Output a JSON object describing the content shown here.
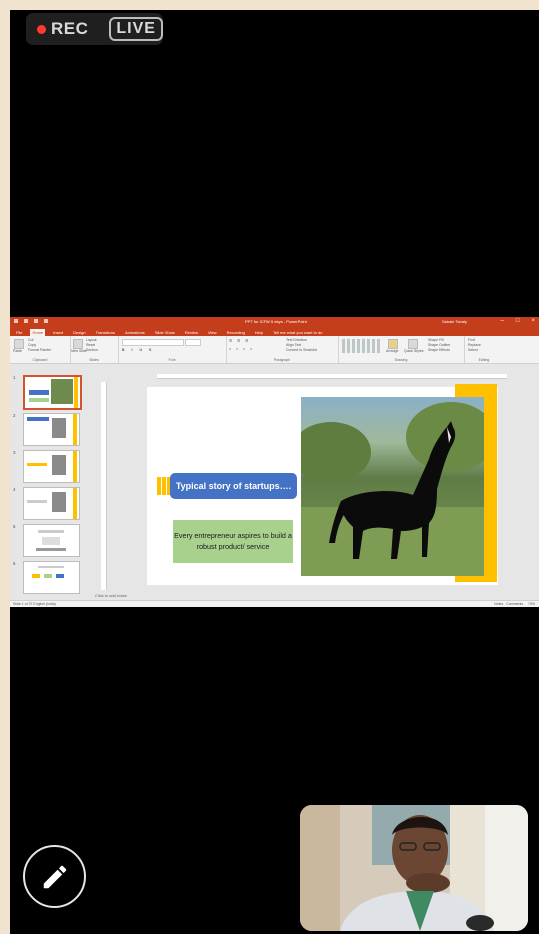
{
  "overlay": {
    "rec_label": "REC",
    "live_label": "LIVE"
  },
  "powerpoint": {
    "document_title": "PPT for ICFW 5 days - PowerPoint",
    "user_name": "Sahale Tavaly",
    "tabs": [
      "File",
      "Home",
      "Insert",
      "Design",
      "Transitions",
      "Animations",
      "Slide Show",
      "Review",
      "View",
      "Recording",
      "Help",
      "Tell me what you want to do"
    ],
    "ribbon": {
      "clipboard": {
        "paste": "Paste",
        "cut": "Cut",
        "copy": "Copy",
        "format_painter": "Format Painter",
        "label": "Clipboard"
      },
      "slides": {
        "new_slide": "New Slide",
        "layout": "Layout",
        "reset": "Reset",
        "section": "Section",
        "label": "Slides"
      },
      "font": {
        "label": "Font"
      },
      "paragraph": {
        "label": "Paragraph",
        "text_direction": "Text Direction",
        "align_text": "Align Text",
        "convert_smartart": "Convert to SmartArt"
      },
      "drawing": {
        "arrange": "Arrange",
        "quick_styles": "Quick Styles",
        "shape_fill": "Shape Fill",
        "shape_outline": "Shape Outline",
        "shape_effects": "Shape Effects",
        "label": "Drawing"
      },
      "editing": {
        "find": "Find",
        "replace": "Replace",
        "select": "Select",
        "label": "Editing"
      }
    },
    "slide": {
      "headline": "Typical story of startups….",
      "body": "Every entrepreneur aspires to build a robust product/ service"
    },
    "thumbnail_numbers": [
      "1",
      "2",
      "3",
      "4",
      "5",
      "6"
    ],
    "notes_placeholder": "Click to add notes",
    "status": {
      "left": "Slide 1 of 37   English (India)",
      "notes": "Notes",
      "comments": "Comments",
      "zoom": "74%"
    }
  },
  "colors": {
    "ppt_accent": "#c43e1c",
    "headline_fill": "#4472c4",
    "body_fill": "#a9d18e",
    "accent_yellow": "#ffc000",
    "rec_dot": "#ff3b30"
  },
  "controls": {
    "annotate_icon": "pencil-icon"
  }
}
